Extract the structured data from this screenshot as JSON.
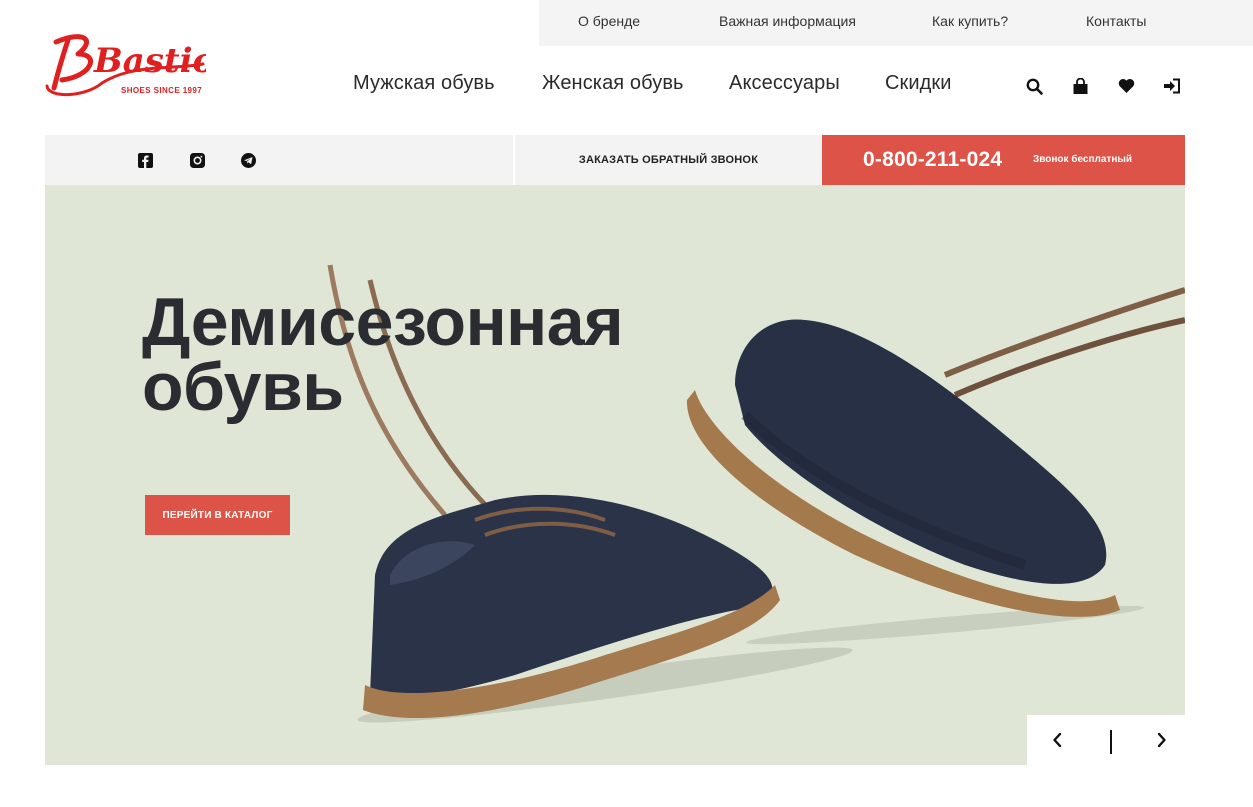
{
  "brand": {
    "logo_text": "Bastion",
    "tagline": "SHOES SINCE 1997",
    "logo_color": "#e02020"
  },
  "topbar": {
    "links": [
      "О бренде",
      "Важная информация",
      "Как купить?",
      "Контакты"
    ]
  },
  "mainnav": {
    "items": [
      "Мужская обувь",
      "Женская обувь",
      "Аксессуары",
      "Скидки"
    ]
  },
  "header_icons": [
    "search-icon",
    "bag-icon",
    "heart-icon",
    "sign-in-icon"
  ],
  "infobar": {
    "social_icons": [
      "facebook-icon",
      "instagram-icon",
      "telegram-icon"
    ],
    "callback_label": "ЗАКАЗАТЬ ОБРАТНЫЙ ЗВОНОК",
    "phone": "0-800-211-024",
    "phone_note": "Звонок бесплатный",
    "accent_color": "#dd5347"
  },
  "hero": {
    "title_line1": "Демисезонная",
    "title_line2": "обувь",
    "cta_label": "ПЕРЕЙТИ В КАТАЛОГ",
    "background_color": "#dfe6d5"
  },
  "slider": {
    "prev_icon": "chevron-left-icon",
    "next_icon": "chevron-right-icon"
  }
}
